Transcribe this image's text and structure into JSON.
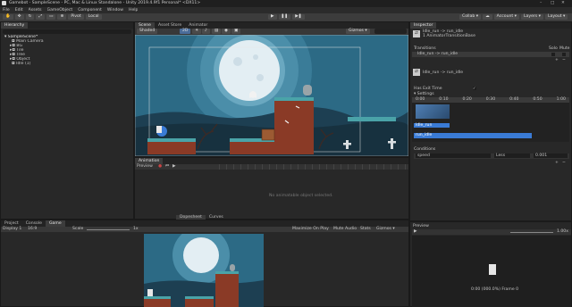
{
  "window_title": "Gamebot - SampleScene - PC, Mac & Linux Standalone - Unity 2019.4.9f1 Personal* <DX11>",
  "menu": [
    "File",
    "Edit",
    "Assets",
    "GameObject",
    "Component",
    "Window",
    "Help"
  ],
  "toolbar": {
    "pivot": "Pivot",
    "local": "Local",
    "collab": "Collab ▾",
    "account": "Account ▾",
    "layers": "Layers ▾",
    "layout": "Layout ▾"
  },
  "hierarchy": {
    "tab": "Hierarchy",
    "items": [
      "SampleScene*",
      "Main Camera",
      "BG",
      "Tile",
      "Tree",
      "Object",
      "Idle (1)"
    ]
  },
  "scene_tabs": [
    "Scene",
    "Asset Store",
    "Animator"
  ],
  "scene_bar": {
    "shading": "Shaded",
    "view2d": "2D",
    "gizmos": "Gizmos ▾"
  },
  "animation": {
    "tab": "Animation",
    "preview": "Preview",
    "empty": "No animatable object selected.",
    "bottom_tabs": [
      "Dopesheet",
      "Curves"
    ]
  },
  "bottom_tabs": [
    "Project",
    "Console",
    "Game"
  ],
  "game_bar": {
    "display": "Display 1",
    "aspect": "16:9",
    "scale_label": "Scale",
    "scale": "1x",
    "maximize": "Maximize On Play",
    "mute": "Mute Audio",
    "stats": "Stats",
    "gizmos": "Gizmos ▾"
  },
  "inspector": {
    "tab": "Inspector",
    "header_title": "Idle_run -> run_idle",
    "header_sub": "1 AnimatorTransitionBase",
    "transitions_label": "Transitions",
    "solo": "Solo",
    "mute": "Mute",
    "transition_row": "Idle_run -> run_idle",
    "sub_title": "Idle_run -> run_idle",
    "has_exit_time": "Has Exit Time",
    "settings": "▾ Settings",
    "timeline_ticks": [
      "0:00",
      "0:10",
      "0:20",
      "0:30",
      "0:40",
      "0:50",
      "1:00"
    ],
    "clip_a": "Idle_run",
    "clip_b": "run_idle",
    "conditions_label": "Conditions",
    "condition": {
      "param": "speed",
      "op": "Less",
      "value": "0.001"
    },
    "preview_label": "Preview",
    "preview_speed": "1.00x",
    "preview_time": "0:00 (000.0%) Frame 0"
  },
  "colors": {
    "sky": "#2e6f8c",
    "moon": "#e3eef3",
    "ground": "#8a3a26",
    "accent_blue": "#3a7bd5"
  }
}
